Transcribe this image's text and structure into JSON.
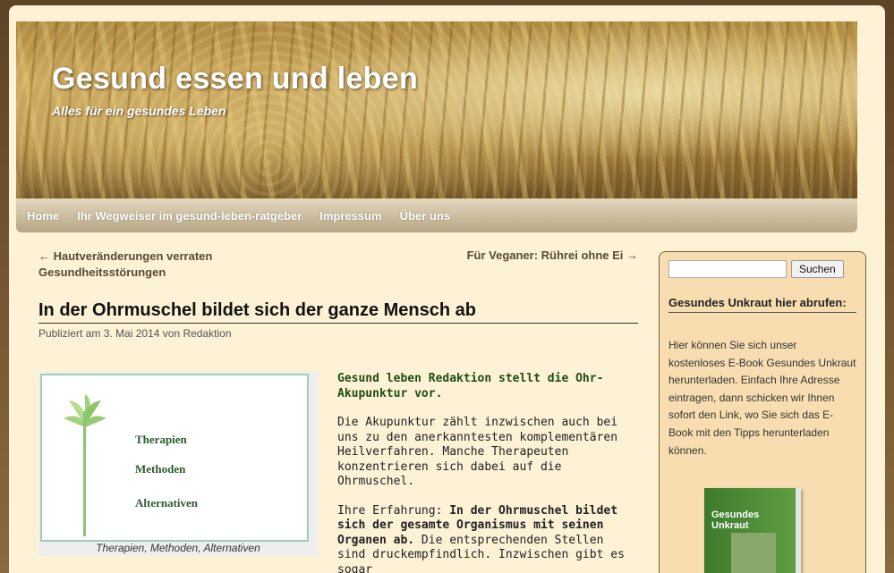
{
  "header": {
    "title": "Gesund essen und leben",
    "description": "Alles für ein gesundes Leben"
  },
  "nav": {
    "items": [
      "Home",
      "Ihr Wegweiser im gesund-leben-ratgeber",
      "Impressum",
      "Über uns"
    ]
  },
  "postnav": {
    "prev": "← Hautveränderungen verraten Gesundheitsstörungen",
    "next": "Für Veganer: Rührei ohne Ei →"
  },
  "post": {
    "title": "In der Ohrmuschel bildet sich der ganze Mensch ab",
    "meta_prefix": "Publiziert am",
    "date": "3. Mai 2014",
    "meta_by": "von",
    "author": "Redaktion",
    "figure": {
      "lines": [
        "Therapien",
        "Methoden",
        "Alternativen"
      ],
      "caption": "Therapien, Methoden, Alternativen"
    },
    "lead": "Gesund leben Redaktion stellt die Ohr-Akupunktur vor.",
    "p1": "Die Akupunktur zählt inzwischen auch bei uns zu den anerkanntesten komplementären Heilverfahren. Manche Therapeuten konzentrieren sich dabei auf die Ohrmuschel.",
    "p2_intro": "Ihre Erfahrung: ",
    "p2_bold": "In der Ohrmuschel bildet sich der gesamte Organismus mit seinen Organen ab.",
    "p2_rest": " Die entsprechenden Stellen sind druckempfindlich. Inzwischen gibt es sogar"
  },
  "sidebar": {
    "search_button": "Suchen",
    "widget_title": "Gesundes Unkraut hier abrufen:",
    "widget_text": "Hier können Sie sich unser kostenloses E-Book Gesundes Unkraut herunterladen. Einfach Ihre Adresse eintragen, dann schicken wir Ihnen sofort den Link, wo Sie sich das E-Book mit den Tipps herunterladen können.",
    "ebook_title": "Gesundes Unkraut"
  }
}
